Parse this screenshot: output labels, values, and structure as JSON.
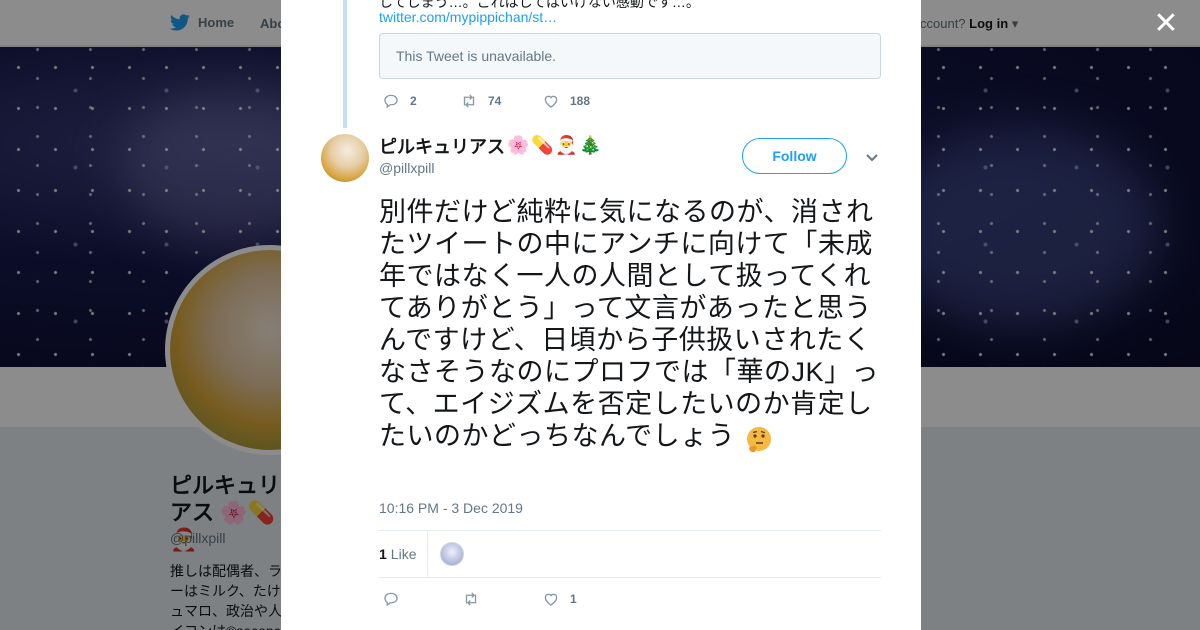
{
  "nav": {
    "home": "Home",
    "about": "Abo",
    "account_prompt": "ccount?",
    "login": "Log in"
  },
  "profile": {
    "name": "ピルキュリアス",
    "handle": "@pillxpill",
    "bio": "推しは配偶者、ラ\nーはミルク、たけ\nュマロ、政治や人\nイコンは©seconc"
  },
  "close_label": "✕",
  "prev_tweet": {
    "text_fragment": "してしまう…。これはしてはいけない感動です…。",
    "link": "twitter.com/mypippichan/st…",
    "unavailable": "This Tweet is unavailable.",
    "replies": "2",
    "retweets": "74",
    "likes": "188"
  },
  "tweet": {
    "name": "ピルキュリアス",
    "name_emojis": [
      "cherry-blossom",
      "pill",
      "santa",
      "christmas-tree"
    ],
    "handle": "@pillxpill",
    "follow_label": "Follow",
    "text": "別件だけど純粋に気になるのが、消されたツイートの中にアンチに向けて「未成年ではなく一人の人間として扱ってくれてありがとう」って文言があったと思うんですけど、日頃から子供扱いされたくなさそうなのにプロフでは「華のJK」って、エイジズムを否定したいのか肯定したいのかどっちなんでしょう",
    "trailing_emoji": "thinking-face",
    "timestamp": "10:16 PM - 3 Dec 2019",
    "like_count": "1",
    "like_label": "Like",
    "actions": {
      "replies": "",
      "retweets": "",
      "likes": "1"
    }
  },
  "colors": {
    "link": "#1da1f2",
    "muted": "#657786",
    "text": "#14171a",
    "thread_line": "#c4dff6"
  }
}
